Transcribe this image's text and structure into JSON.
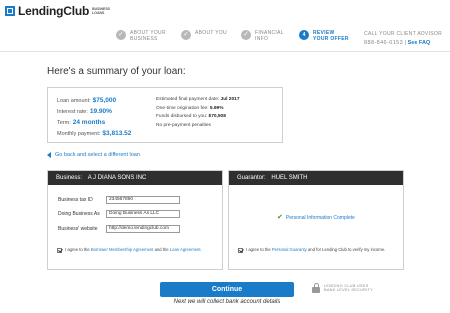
{
  "brand": {
    "name": "LendingClub",
    "sub_line1": "BUSINESS",
    "sub_line2": "LOANS"
  },
  "steps": [
    {
      "icon": "check-icon",
      "glyph": "✓",
      "line1": "ABOUT YOUR",
      "line2": "BUSINESS",
      "state": "complete"
    },
    {
      "icon": "check-icon",
      "glyph": "✓",
      "line1": "ABOUT YOU",
      "line2": "",
      "state": "complete"
    },
    {
      "icon": "check-icon",
      "glyph": "✓",
      "line1": "FINANCIAL",
      "line2": "INFO",
      "state": "complete"
    },
    {
      "icon": "",
      "glyph": "4",
      "line1": "REVIEW",
      "line2": "YOUR OFFER",
      "state": "active"
    }
  ],
  "advisor": {
    "title": "CALL YOUR CLIENT ADVISOR",
    "phone": "888-846-0153",
    "separator": "|",
    "faq": "See FAQ"
  },
  "summary": {
    "title": "Here's a summary of your loan:",
    "loan_amount_label": "Loan amount:",
    "loan_amount": "$75,000",
    "interest_rate_label": "Interest rate:",
    "interest_rate": "19.90%",
    "term_label": "Term:",
    "term": "24 months",
    "monthly_payment_label": "Monthly payment:",
    "monthly_payment": "$3,813.52",
    "final_payment_label": "Estimated final payment date:",
    "final_payment": "Jul 2017",
    "origination_fee_label": "One-time origination fee:",
    "origination_fee": "5.99%",
    "funds_disbursed_label": "Funds disbursed to you:",
    "funds_disbursed": "$70,508",
    "prepayment": "No pre-payment penalties"
  },
  "back_link": "Go back and select a different loan",
  "business": {
    "header_label": "Business:",
    "header_name": "A J DIANA SONS INC",
    "tax_id_label": "Business tax ID",
    "tax_id_value": "234567890",
    "dba_label": "Doing Business As",
    "dba_value": "Doing Business As LLC",
    "website_label": "Business' website",
    "website_value": "http://demo.lendingclub.com",
    "agree_prefix": "I agree to the",
    "agree_link1": "Borrower Membership Agreement",
    "agree_mid": "and the",
    "agree_link2": "Loan Agreement."
  },
  "guarantor": {
    "header_label": "Guarantor:",
    "header_name": "HUEL SMITH",
    "status": "Personal Information Complete",
    "agree_prefix": "I agree to the",
    "agree_link": "Personal Guaranty",
    "agree_suffix": "and for Lending Club to verify my income."
  },
  "continue_label": "Continue",
  "next_step": "Next we will collect bank account details",
  "security": {
    "line1": "LENDING CLUB USES",
    "line2": "BANK LEVEL SECURITY"
  },
  "colors": {
    "accent": "#1a7bc8",
    "panel_header": "#2f2f2f",
    "complete_check": "#3a9a3a"
  }
}
